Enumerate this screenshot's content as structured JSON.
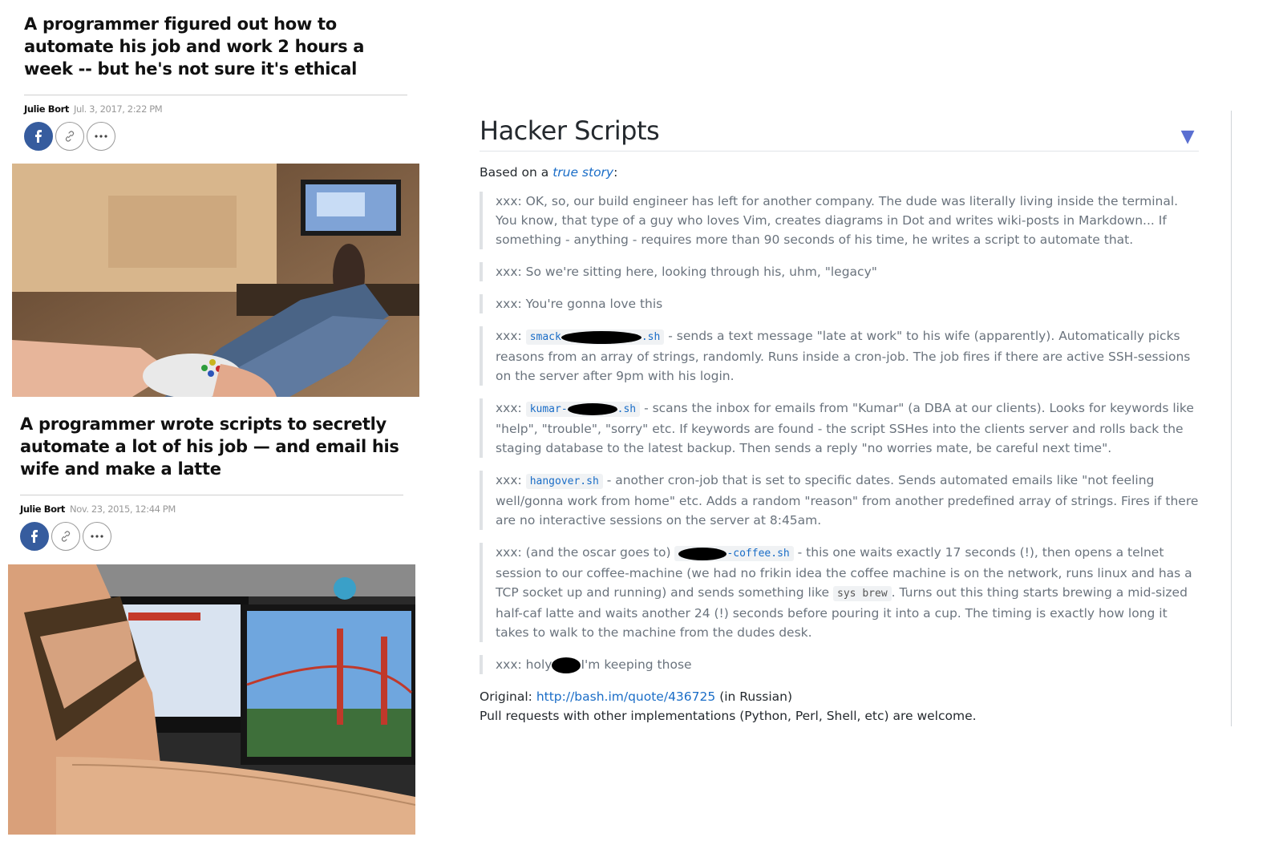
{
  "articles": [
    {
      "headline": "A programmer figured out how to automate his job and work 2 hours a week -- but he's not sure it's ethical",
      "author": "Julie Bort",
      "date": "Jul. 3, 2017, 2:22 PM"
    },
    {
      "headline": "A programmer wrote scripts to secretly automate a lot of his job — and email his wife and make a latte",
      "author": "Julie Bort",
      "date": "Nov. 23, 2015, 12:44 PM"
    }
  ],
  "share_icons": [
    "facebook-icon",
    "link-icon",
    "more-icon"
  ],
  "readme": {
    "title": "Hacker Scripts",
    "toggle": "▼",
    "intro_prefix": "Based on a",
    "intro_link": "true story",
    "intro_suffix": ":",
    "quotes": {
      "q1": "xxx: OK, so, our build engineer has left for another company. The dude was literally living inside the terminal. You know, that type of a guy who loves Vim, creates diagrams in Dot and writes wiki-posts in Markdown... If something - anything - requires more than 90 seconds of his time, he writes a script to automate that.",
      "q2": "xxx: So we're sitting here, looking through his, uhm, \"legacy\"",
      "q3": "xxx: You're gonna love this",
      "q4_prefix": "xxx:",
      "q4_code_a": "smack",
      "q4_code_b": ".sh",
      "q4_text": " - sends a text message \"late at work\" to his wife (apparently). Automatically picks reasons from an array of strings, randomly. Runs inside a cron-job. The job fires if there are active SSH-sessions on the server after 9pm with his login.",
      "q5_prefix": "xxx:",
      "q5_code_a": "kumar-",
      "q5_code_b": ".sh",
      "q5_text": " - scans the inbox for emails from \"Kumar\" (a DBA at our clients). Looks for keywords like \"help\", \"trouble\", \"sorry\" etc. If keywords are found - the script SSHes into the clients server and rolls back the staging database to the latest backup. Then sends a reply \"no worries mate, be careful next time\".",
      "q6_prefix": "xxx:",
      "q6_code": "hangover.sh",
      "q6_text": " - another cron-job that is set to specific dates. Sends automated emails like \"not feeling well/gonna work from home\" etc. Adds a random \"reason\" from another predefined array of strings. Fires if there are no interactive sessions on the server at 8:45am.",
      "q7_prefix": "xxx: (and the oscar goes to)",
      "q7_code": "-coffee.sh",
      "q7_text_a": " - this one waits exactly 17 seconds (!), then opens a telnet session to our coffee-machine (we had no frikin idea the coffee machine is on the network, runs linux and has a TCP socket up and running) and sends something like ",
      "q7_code2": "sys brew",
      "q7_text_b": ". Turns out this thing starts brewing a mid-sized half-caf latte and waits another 24 (!) seconds before pouring it into a cup. The timing is exactly how long it takes to walk to the machine from the dudes desk.",
      "q8_prefix": "xxx: holy",
      "q8_text": "I'm keeping those"
    },
    "original_label": "Original:",
    "original_link": "http://bash.im/quote/436725",
    "original_suffix": "(in Russian)",
    "pull_requests": "Pull requests with other implementations (Python, Perl, Shell, etc) are welcome."
  }
}
